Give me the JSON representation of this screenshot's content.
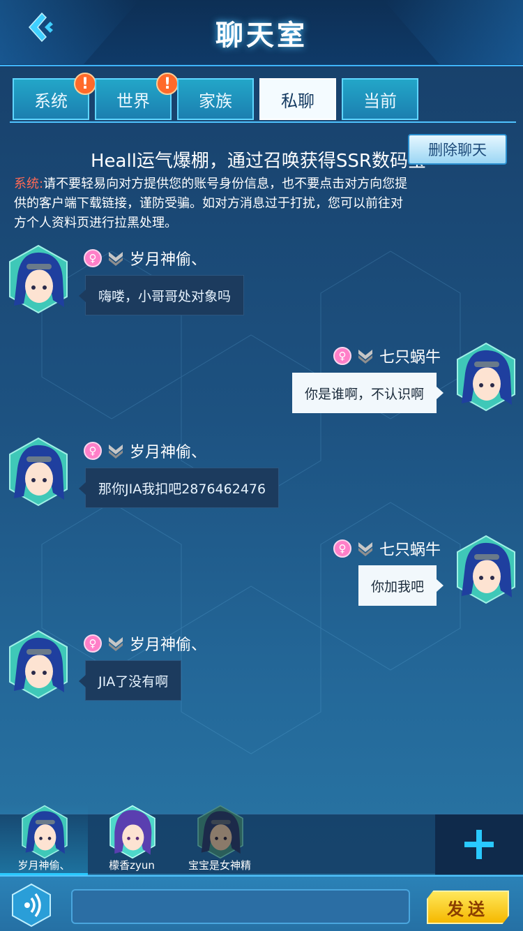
{
  "header": {
    "title": "聊天室",
    "back_icon": "back-chevron-icon"
  },
  "tabs": [
    {
      "label": "系统",
      "alert": "!"
    },
    {
      "label": "世界",
      "alert": "!"
    },
    {
      "label": "家族",
      "alert": ""
    },
    {
      "label": "私聊",
      "alert": ""
    },
    {
      "label": "当前",
      "alert": ""
    }
  ],
  "active_tab": "私聊",
  "delete_button": "删除聊天",
  "marquee": "Heall运气爆棚，通过召唤获得SSR数码宝",
  "system_notice": {
    "label": "系统:",
    "text": "请不要轻易向对方提供您的账号身份信息，也不要点击对方向您提供的客户端下载链接，谨防受骗。如对方消息过于打扰，您可以前往对方个人资料页进行拉黑处理。"
  },
  "messages": [
    {
      "side": "left",
      "name": "岁月神偷、",
      "text": "嗨喽，小哥哥处对象吗"
    },
    {
      "side": "right",
      "name": "七只蜗牛",
      "text": "你是谁啊，不认识啊"
    },
    {
      "side": "left",
      "name": "岁月神偷、",
      "text": "那你JIA我扣吧2876462476"
    },
    {
      "side": "right",
      "name": "七只蜗牛",
      "text": "你加我吧"
    },
    {
      "side": "left",
      "name": "岁月神偷、",
      "text": "JIA了没有啊"
    }
  ],
  "contacts": [
    {
      "name": "岁月神偷、",
      "selected": true
    },
    {
      "name": "檬香zyun",
      "selected": false
    },
    {
      "name": "宝宝是女神精",
      "selected": false
    }
  ],
  "input": {
    "value": "",
    "placeholder": ""
  },
  "send_button": "发送",
  "colors": {
    "accent": "#4fc3ff",
    "alert": "#ff6a2a",
    "system_label": "#ff6a55",
    "send": "#f5b800"
  }
}
